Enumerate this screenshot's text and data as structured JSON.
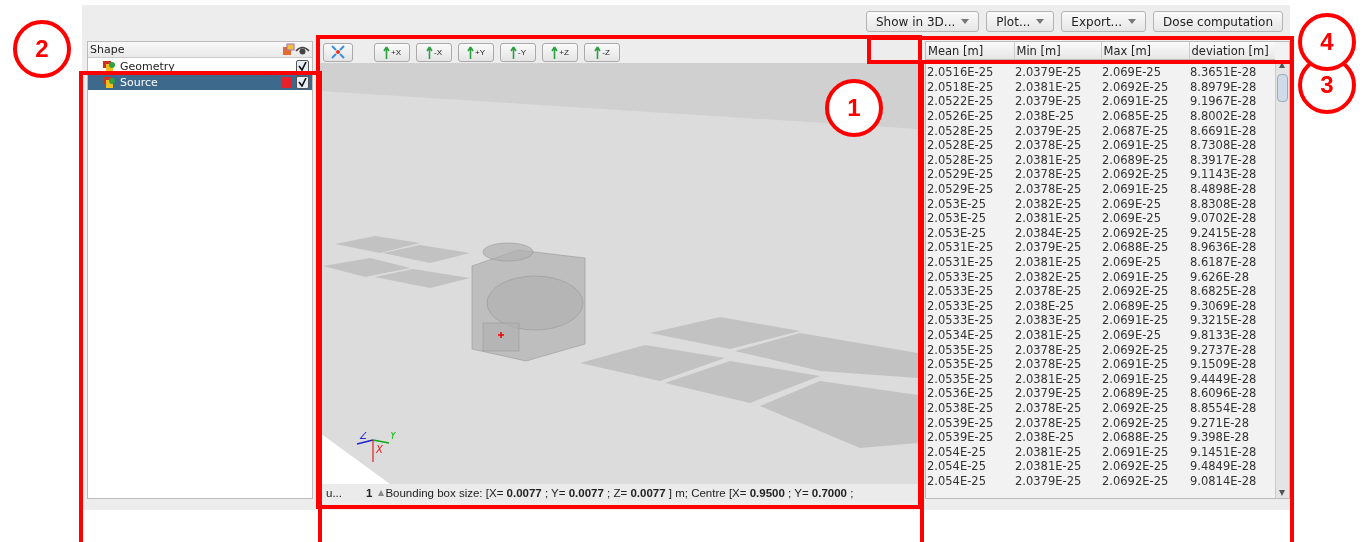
{
  "toolbar": {
    "buttons": [
      {
        "label": "Show in 3D...",
        "has_menu": true
      },
      {
        "label": "Plot...",
        "has_menu": true
      },
      {
        "label": "Export...",
        "has_menu": true
      },
      {
        "label": "Dose computation",
        "has_menu": false
      }
    ]
  },
  "tree": {
    "header": "Shape",
    "items": [
      {
        "label": "Geometry",
        "selected": false,
        "checked": true
      },
      {
        "label": "Source",
        "selected": true,
        "checked": true,
        "color": "#e8202a"
      }
    ]
  },
  "viewport": {
    "view_buttons": [
      "+X",
      "-X",
      "+Y",
      "-Y",
      "+Z",
      "-Z"
    ],
    "axis_labels": [
      "Z",
      "Y",
      "X"
    ],
    "status": {
      "cut_text": "u...",
      "count": "1",
      "text": "Bounding box size: [X= **0.0077** ; Y= **0.0077** ; Z= **0.0077** ] m;  Centre [X= **0.9500** ; Y= **0.7000** ;"
    }
  },
  "table": {
    "columns": [
      "Mean [m]",
      "Min [m]",
      "Max [m]",
      "deviation [m]"
    ],
    "rows": [
      [
        "2.0516E-25",
        "2.0379E-25",
        "2.069E-25",
        "8.3651E-28"
      ],
      [
        "2.0518E-25",
        "2.0381E-25",
        "2.0692E-25",
        "8.8979E-28"
      ],
      [
        "2.0522E-25",
        "2.0379E-25",
        "2.0691E-25",
        "9.1967E-28"
      ],
      [
        "2.0526E-25",
        "2.038E-25",
        "2.0685E-25",
        "8.8002E-28"
      ],
      [
        "2.0528E-25",
        "2.0379E-25",
        "2.0687E-25",
        "8.6691E-28"
      ],
      [
        "2.0528E-25",
        "2.0378E-25",
        "2.0691E-25",
        "8.7308E-28"
      ],
      [
        "2.0528E-25",
        "2.0381E-25",
        "2.0689E-25",
        "8.3917E-28"
      ],
      [
        "2.0529E-25",
        "2.0378E-25",
        "2.0692E-25",
        "9.1143E-28"
      ],
      [
        "2.0529E-25",
        "2.0378E-25",
        "2.0691E-25",
        "8.4898E-28"
      ],
      [
        "2.053E-25",
        "2.0382E-25",
        "2.069E-25",
        "8.8308E-28"
      ],
      [
        "2.053E-25",
        "2.0381E-25",
        "2.069E-25",
        "9.0702E-28"
      ],
      [
        "2.053E-25",
        "2.0384E-25",
        "2.0692E-25",
        "9.2415E-28"
      ],
      [
        "2.0531E-25",
        "2.0379E-25",
        "2.0688E-25",
        "8.9636E-28"
      ],
      [
        "2.0531E-25",
        "2.0381E-25",
        "2.069E-25",
        "8.6187E-28"
      ],
      [
        "2.0533E-25",
        "2.0382E-25",
        "2.0691E-25",
        "9.626E-28"
      ],
      [
        "2.0533E-25",
        "2.0378E-25",
        "2.0692E-25",
        "8.6825E-28"
      ],
      [
        "2.0533E-25",
        "2.038E-25",
        "2.0689E-25",
        "9.3069E-28"
      ],
      [
        "2.0533E-25",
        "2.0383E-25",
        "2.0691E-25",
        "9.3215E-28"
      ],
      [
        "2.0534E-25",
        "2.0381E-25",
        "2.069E-25",
        "9.8133E-28"
      ],
      [
        "2.0535E-25",
        "2.0378E-25",
        "2.0692E-25",
        "9.2737E-28"
      ],
      [
        "2.0535E-25",
        "2.0378E-25",
        "2.0691E-25",
        "9.1509E-28"
      ],
      [
        "2.0535E-25",
        "2.0381E-25",
        "2.0691E-25",
        "9.4449E-28"
      ],
      [
        "2.0536E-25",
        "2.0379E-25",
        "2.0689E-25",
        "8.6096E-28"
      ],
      [
        "2.0538E-25",
        "2.0378E-25",
        "2.0692E-25",
        "8.8554E-28"
      ],
      [
        "2.0539E-25",
        "2.0378E-25",
        "2.0692E-25",
        "9.271E-28"
      ],
      [
        "2.0539E-25",
        "2.038E-25",
        "2.0688E-25",
        "9.398E-28"
      ],
      [
        "2.054E-25",
        "2.0381E-25",
        "2.0691E-25",
        "9.1451E-28"
      ],
      [
        "2.054E-25",
        "2.0381E-25",
        "2.0692E-25",
        "9.4849E-28"
      ],
      [
        "2.054E-25",
        "2.0379E-25",
        "2.0692E-25",
        "9.0814E-28"
      ]
    ]
  },
  "annotations": [
    {
      "label": "1"
    },
    {
      "label": "2"
    },
    {
      "label": "3"
    },
    {
      "label": "4"
    }
  ]
}
